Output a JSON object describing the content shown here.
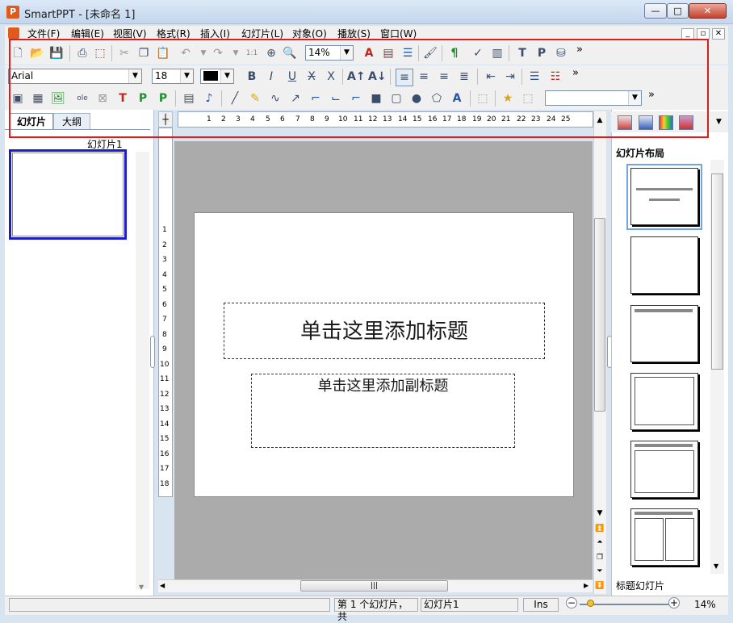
{
  "window": {
    "title": "SmartPPT - [未命名 1]",
    "minimize": "—",
    "maximize": "□",
    "close": "✕"
  },
  "app_icon": "P",
  "menu": [
    "文件(F)",
    "编辑(E)",
    "视图(V)",
    "格式(R)",
    "插入(I)",
    "幻灯片(L)",
    "对象(O)",
    "播放(S)",
    "窗口(W)"
  ],
  "doc_controls": {
    "min": "_",
    "max": "▫",
    "close": "✕"
  },
  "toolbar1": {
    "zoom": "14%",
    "more": "»"
  },
  "toolbar2": {
    "font": "Arial",
    "size": "18",
    "more": "»"
  },
  "toolbar3": {
    "more": "»"
  },
  "left_panel": {
    "tab_slides": "幻灯片",
    "tab_outline": "大纲",
    "thumb_label": "幻灯片1"
  },
  "ruler": {
    "h": [
      "1",
      "2",
      "3",
      "4",
      "5",
      "6",
      "7",
      "8",
      "9",
      "10",
      "11",
      "12",
      "13",
      "14",
      "15",
      "16",
      "17",
      "18",
      "19",
      "20",
      "21",
      "22",
      "23",
      "24",
      "25"
    ],
    "v": [
      "1",
      "2",
      "3",
      "4",
      "5",
      "6",
      "7",
      "8",
      "9",
      "10",
      "11",
      "12",
      "13",
      "14",
      "15",
      "16",
      "17",
      "18"
    ]
  },
  "slide": {
    "title_placeholder": "单击这里添加标题",
    "subtitle_placeholder": "单击这里添加副标题"
  },
  "right_panel": {
    "title": "幻灯片布局",
    "footer": "标题幻灯片"
  },
  "status": {
    "slide_of": "第 1 个幻灯片，共",
    "slide_name": "幻灯片1",
    "mode": "Ins",
    "zoom": "14%"
  },
  "icons": {
    "new": "new-document-icon",
    "open": "open-folder-icon",
    "save": "save-icon"
  }
}
